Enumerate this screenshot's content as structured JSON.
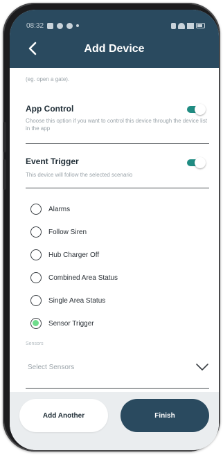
{
  "status_bar": {
    "time": "08:32"
  },
  "header": {
    "title": "Add Device",
    "back_icon": "chevron-left-icon"
  },
  "hint_top": "(eg. open a gate).",
  "app_control": {
    "title": "App Control",
    "description": "Choose this option if you want to control this device through the device list in the app",
    "enabled": true
  },
  "event_trigger": {
    "title": "Event Trigger",
    "description": "This device will follow the selected scenario",
    "enabled": true
  },
  "scenarios": [
    {
      "label": "Alarms",
      "selected": false
    },
    {
      "label": "Follow Siren",
      "selected": false
    },
    {
      "label": "Hub Charger Off",
      "selected": false
    },
    {
      "label": "Combined Area Status",
      "selected": false
    },
    {
      "label": "Single Area Status",
      "selected": false
    },
    {
      "label": "Sensor Trigger",
      "selected": true
    }
  ],
  "sensors": {
    "label": "Sensors",
    "placeholder": "Select Sensors",
    "icon": "chevron-down-icon"
  },
  "footer": {
    "add_another_label": "Add Another",
    "finish_label": "Finish"
  },
  "colors": {
    "header": "#2a4a5f",
    "toggle_on": "#1f8c82",
    "radio_selected": "#6fdc8c",
    "finish_button": "#2a4a5f",
    "bottom_bar": "#eaedef"
  }
}
